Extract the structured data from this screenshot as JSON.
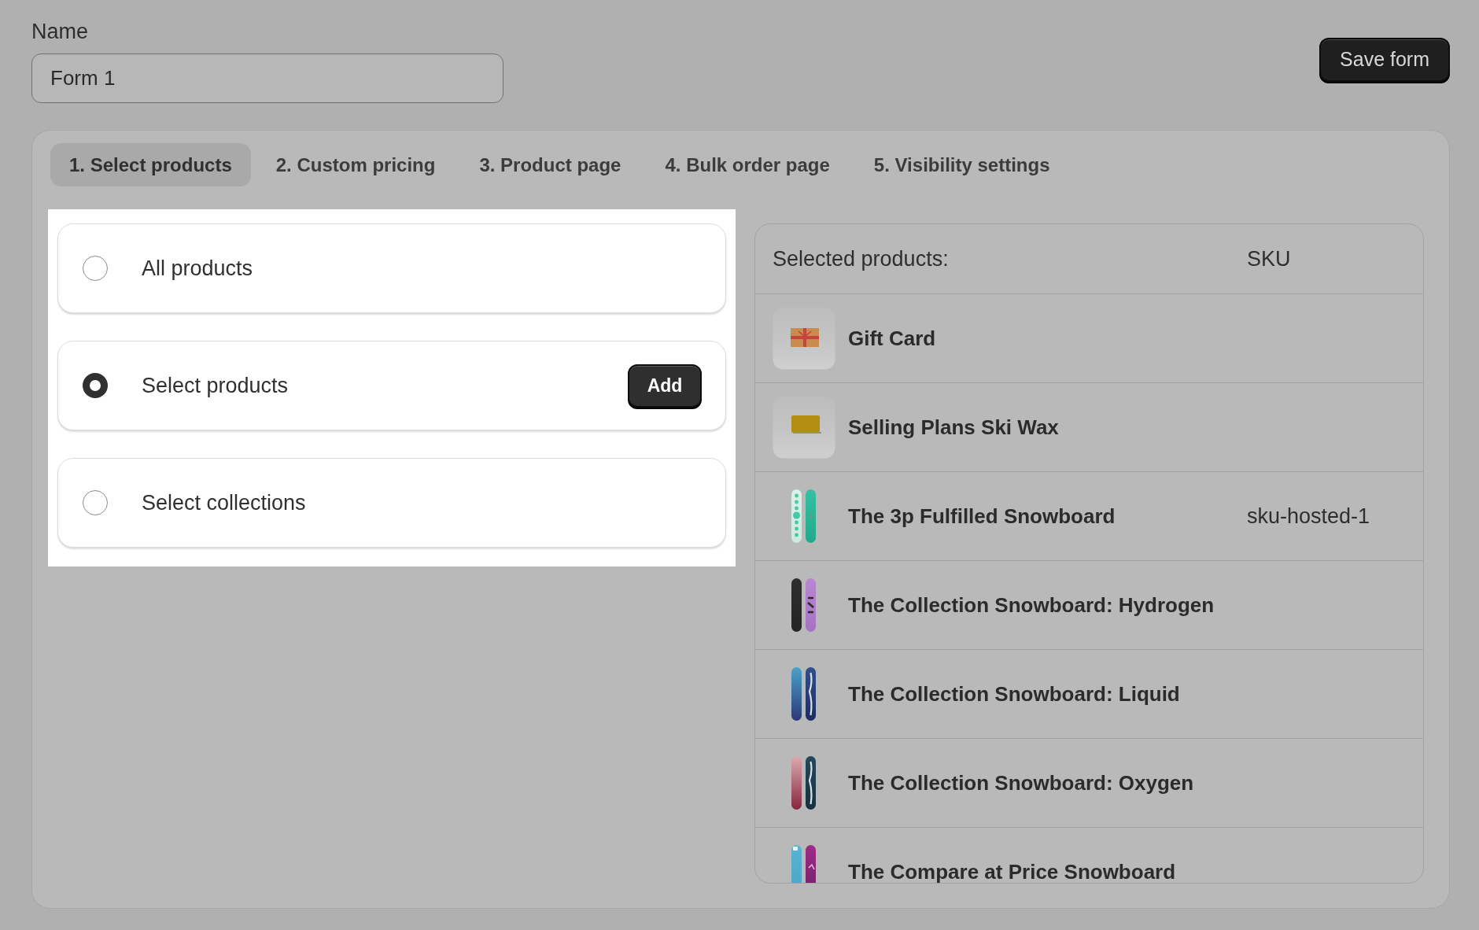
{
  "name_field": {
    "label": "Name",
    "value": "Form 1"
  },
  "save_button": "Save form",
  "tabs": [
    {
      "label": "1. Select products",
      "selected": true
    },
    {
      "label": "2. Custom pricing",
      "selected": false
    },
    {
      "label": "3. Product page",
      "selected": false
    },
    {
      "label": "4. Bulk order page",
      "selected": false
    },
    {
      "label": "5. Visibility settings",
      "selected": false
    }
  ],
  "product_scope": {
    "options": [
      {
        "label": "All products",
        "selected": false
      },
      {
        "label": "Select products",
        "selected": true,
        "button": "Add"
      },
      {
        "label": "Select collections",
        "selected": false
      }
    ]
  },
  "selected_products": {
    "columns": [
      "Selected products:",
      "SKU"
    ],
    "rows": [
      {
        "kind": "gift",
        "name": "Gift Card"
      },
      {
        "kind": "wax",
        "name": "Selling Plans Ski Wax"
      },
      {
        "kind": "snowboard",
        "name": "The 3p Fulfilled Snowboard",
        "sku": "sku-hosted-1"
      },
      {
        "kind": "snowboard",
        "name": "The Collection Snowboard: Hydrogen"
      },
      {
        "kind": "snowboard",
        "name": "The Collection Snowboard: Liquid"
      },
      {
        "kind": "snowboard",
        "name": "The Collection Snowboard: Oxygen"
      },
      {
        "kind": "snowboard",
        "name": "The Compare at Price Snowboard"
      }
    ]
  }
}
